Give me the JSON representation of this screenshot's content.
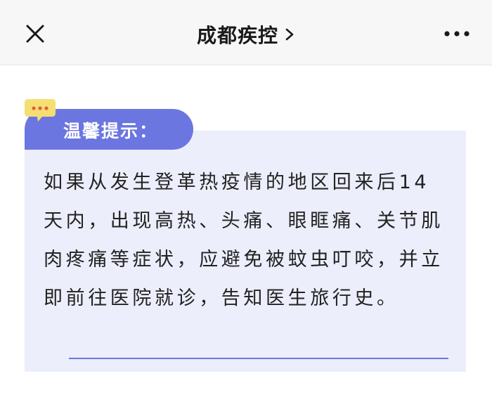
{
  "header": {
    "title": "成都疾控",
    "close_icon": "close-icon",
    "chevron_icon": "chevron-right-icon",
    "more_icon": "more-icon"
  },
  "notice": {
    "label": "温馨提示：",
    "bubble_icon": "speech-bubble-icon",
    "body": "如果从发生登革热疫情的地区回来后14天内，出现高热、头痛、眼眶痛、关节肌肉疼痛等症状，应避免被蚊虫叮咬，并立即前往医院就诊，告知医生旅行史。"
  },
  "colors": {
    "accent": "#6b76e0",
    "card_background": "#eceefb",
    "bubble": "#f6df72",
    "topbar": "#f7f7f7"
  }
}
